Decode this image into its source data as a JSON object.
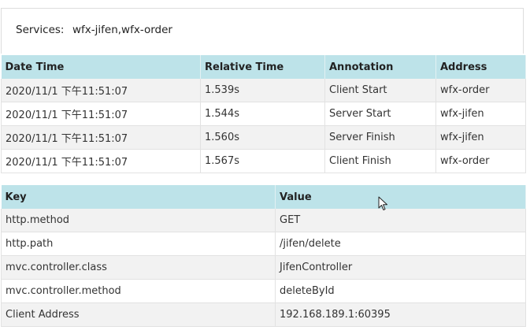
{
  "services": {
    "label": "Services:",
    "value": "wfx-jifen,wfx-order"
  },
  "span_table": {
    "headers": [
      "Date Time",
      "Relative Time",
      "Annotation",
      "Address"
    ],
    "rows": [
      [
        "2020/11/1 下午11:51:07",
        "1.539s",
        "Client Start",
        "wfx-order"
      ],
      [
        "2020/11/1 下午11:51:07",
        "1.544s",
        "Server Start",
        "wfx-jifen"
      ],
      [
        "2020/11/1 下午11:51:07",
        "1.560s",
        "Server Finish",
        "wfx-jifen"
      ],
      [
        "2020/11/1 下午11:51:07",
        "1.567s",
        "Client Finish",
        "wfx-order"
      ]
    ]
  },
  "tag_table": {
    "headers": [
      "Key",
      "Value"
    ],
    "rows": [
      [
        "http.method",
        "GET"
      ],
      [
        "http.path",
        "/jifen/delete"
      ],
      [
        "mvc.controller.class",
        "JifenController"
      ],
      [
        "mvc.controller.method",
        "deleteById"
      ],
      [
        "Client Address",
        "192.168.189.1:60395"
      ]
    ]
  },
  "colors": {
    "header_bg": "#bde3e9",
    "stripe_bg": "#f2f2f2"
  },
  "icons": {
    "cursor": "mouse-pointer-icon"
  }
}
